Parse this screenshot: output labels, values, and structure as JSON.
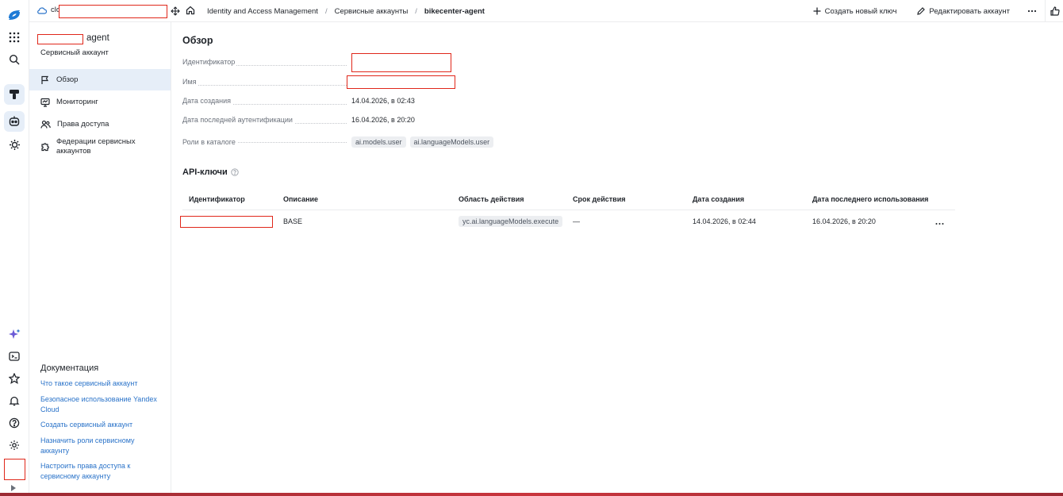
{
  "topbar": {
    "cloud_prefix": "clo",
    "breadcrumbs": [
      "Identity and Access Management",
      "Сервисные аккаунты",
      "bikecenter-agent"
    ],
    "create_key_label": "Создать новый ключ",
    "edit_account_label": "Редактировать аккаунт"
  },
  "sidebar": {
    "account_name_suffix": "agent",
    "account_type": "Сервисный аккаунт",
    "items": [
      {
        "label": "Обзор",
        "icon": "flag-icon"
      },
      {
        "label": "Мониторинг",
        "icon": "monitor-icon"
      },
      {
        "label": "Права доступа",
        "icon": "users-icon"
      },
      {
        "label": "Федерации сервисных аккаунтов",
        "icon": "puzzle-icon"
      }
    ],
    "docs_title": "Документация",
    "docs_links": [
      "Что такое сервисный аккаунт",
      "Безопасное использование Yandex Cloud",
      "Создать сервисный аккаунт",
      "Назначить роли сервисному аккаунту",
      "Настроить права доступа к сервисному аккаунту"
    ]
  },
  "overview": {
    "title": "Обзор",
    "fields": {
      "id_label": "Идентификатор",
      "name_label": "Имя",
      "created_label": "Дата создания",
      "created_value": "14.04.2026, в 02:43",
      "last_auth_label": "Дата последней аутентификации",
      "last_auth_value": "16.04.2026, в 20:20",
      "roles_label": "Роли в каталоге",
      "roles": [
        "ai.models.user",
        "ai.languageModels.user"
      ]
    }
  },
  "api_keys": {
    "title": "API-ключи",
    "columns": [
      "Идентификатор",
      "Описание",
      "Область действия",
      "Срок действия",
      "Дата создания",
      "Дата последнего использования"
    ],
    "rows": [
      {
        "description": "BASE",
        "scope": "yc.ai.languageModels.execute",
        "expires": "—",
        "created": "14.04.2026, в 02:44",
        "last_used": "16.04.2026, в 20:20"
      }
    ]
  },
  "colors": {
    "accent": "#2a73c9",
    "active_bg": "#e6eef8",
    "redaction": "#e0271a",
    "chip_bg": "#eceef1"
  }
}
